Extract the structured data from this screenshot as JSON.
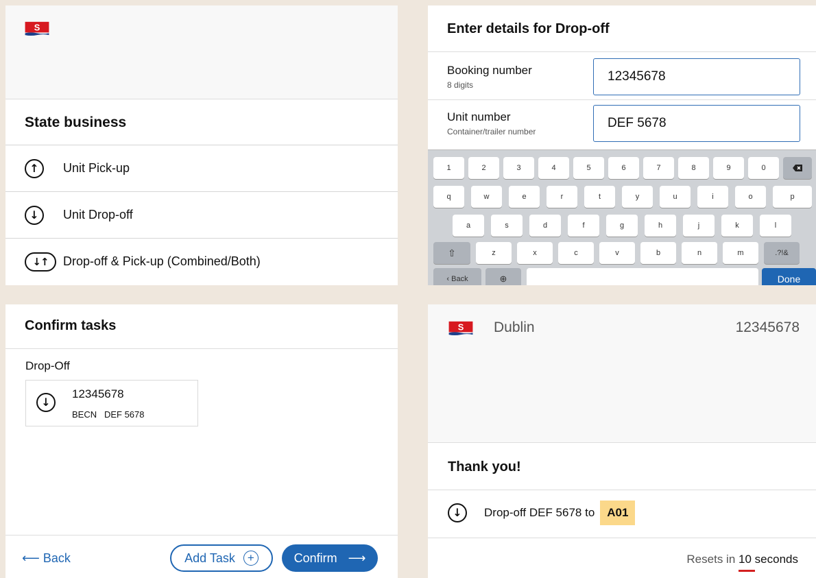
{
  "brand": {
    "logo_letter": "S",
    "logo_color": "#d71920",
    "accent": "#1f66b3",
    "highlight": "#fbd88a"
  },
  "state_business": {
    "title": "State business",
    "options": [
      {
        "label": "Unit Pick-up",
        "icon": "arrow-up-circle-icon"
      },
      {
        "label": "Unit Drop-off",
        "icon": "arrow-down-circle-icon"
      },
      {
        "label": "Drop-off & Pick-up (Combined/Both)",
        "icon": "arrows-down-up-pill-icon"
      }
    ]
  },
  "drop_off_form": {
    "title": "Enter details for Drop-off",
    "booking": {
      "label": "Booking number",
      "hint": "8 digits",
      "value": "12345678"
    },
    "unit": {
      "label": "Unit number",
      "hint": "Container/trailer number",
      "value": "DEF 5678"
    },
    "keyboard": {
      "row1": [
        "1",
        "2",
        "3",
        "4",
        "5",
        "6",
        "7",
        "8",
        "9",
        "0"
      ],
      "row2": [
        "q",
        "w",
        "e",
        "r",
        "t",
        "y",
        "u",
        "i",
        "o",
        "p"
      ],
      "row3": [
        "a",
        "s",
        "d",
        "f",
        "g",
        "h",
        "j",
        "k",
        "l"
      ],
      "row4": [
        "z",
        "x",
        "c",
        "v",
        "b",
        "n",
        "m",
        ".?!&"
      ],
      "back": "‹ Back",
      "done": "Done"
    }
  },
  "confirm_tasks": {
    "title": "Confirm tasks",
    "section": "Drop-Off",
    "task": {
      "booking": "12345678",
      "port": "BECN",
      "unit": "DEF 5678"
    },
    "back": "Back",
    "add_task": "Add Task",
    "confirm": "Confirm"
  },
  "thank_you": {
    "city": "Dublin",
    "booking": "12345678",
    "title": "Thank you!",
    "line": "Drop-off DEF 5678 to",
    "gate": "A01",
    "resets_prefix": "Resets in",
    "resets_seconds": "10",
    "resets_suffix": "seconds"
  }
}
